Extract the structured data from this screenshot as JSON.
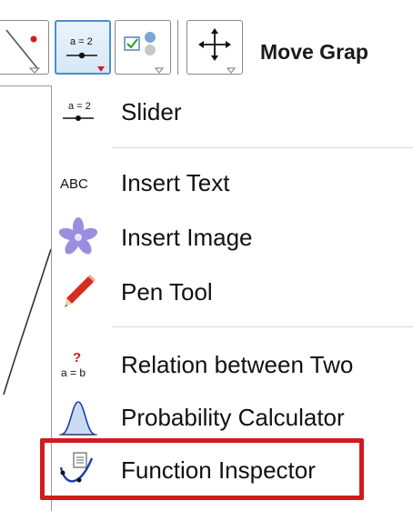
{
  "toolbar": {
    "title": "Move Grap",
    "buttons": [
      {
        "icon": "point-on-line-icon"
      },
      {
        "icon": "slider-icon",
        "label": "a = 2",
        "active": true
      },
      {
        "icon": "checkbox-show-objects-icon"
      },
      {
        "icon": "move-graphics-view-icon"
      }
    ]
  },
  "menu": {
    "items": [
      {
        "label": "Slider",
        "icon": "slider-icon",
        "icon_text": "a = 2"
      },
      {
        "label": "Insert Text",
        "icon": "insert-text-icon",
        "icon_text": "ABC"
      },
      {
        "label": "Insert Image",
        "icon": "insert-image-icon"
      },
      {
        "label": "Pen Tool",
        "icon": "pen-tool-icon"
      },
      {
        "label": "Relation between Two",
        "icon": "relation-icon",
        "icon_text": "a = b",
        "icon_mark": "?"
      },
      {
        "label": "Probability Calculator",
        "icon": "probability-calculator-icon"
      },
      {
        "label": "Function Inspector",
        "icon": "function-inspector-icon",
        "highlighted": true
      }
    ]
  },
  "colors": {
    "highlight": "#d01c1c",
    "active_button": "#4a8fd1",
    "accent_icon_blue": "#1f3fa8",
    "pen_red": "#d62d20",
    "flower_purple": "#9b8ee0"
  }
}
